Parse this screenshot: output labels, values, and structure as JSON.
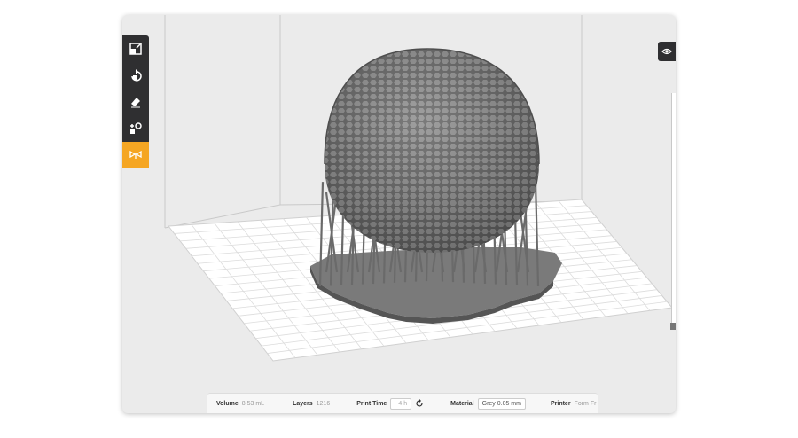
{
  "toolbar": {
    "tools": [
      {
        "icon": "scale-icon"
      },
      {
        "icon": "rotate-icon"
      },
      {
        "icon": "eraser-icon"
      },
      {
        "icon": "layout-icon"
      },
      {
        "icon": "supports-icon",
        "active": true
      }
    ]
  },
  "view_toggle": {
    "icon": "eye-view-icon"
  },
  "status": {
    "volume_label": "Volume",
    "volume_value": "8.53 mL",
    "layers_label": "Layers",
    "layers_value": "1216",
    "print_time_label": "Print Time",
    "print_time_value": "~4 h",
    "material_label": "Material",
    "material_value": "Grey 0.05 mm",
    "printer_label": "Printer",
    "printer_value": "Form Fr"
  },
  "colors": {
    "accent": "#f5a623",
    "toolbar_bg": "#2f2f31",
    "model": "#6f6f6f",
    "canvas": "#ebebeb"
  }
}
